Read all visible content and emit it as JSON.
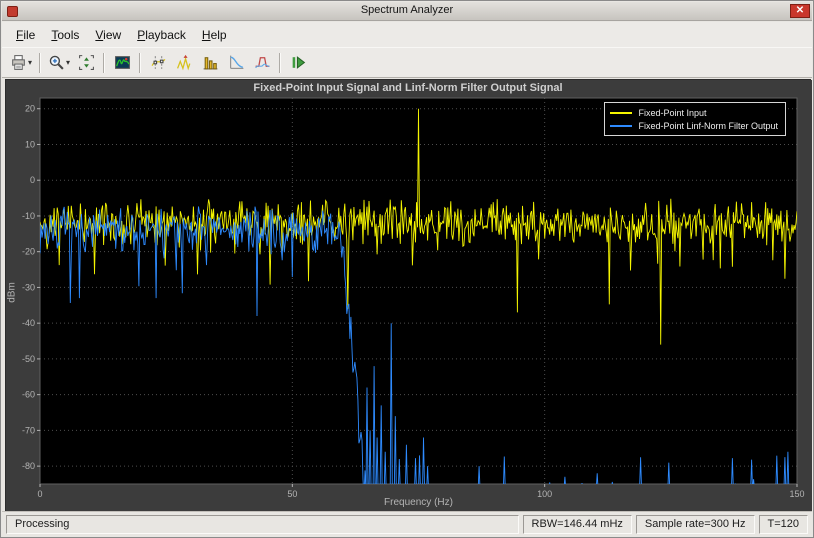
{
  "window": {
    "title": "Spectrum Analyzer",
    "close_glyph": "✕"
  },
  "menubar": {
    "items": [
      {
        "label": "File"
      },
      {
        "label": "Tools"
      },
      {
        "label": "View"
      },
      {
        "label": "Playback"
      },
      {
        "label": "Help"
      }
    ]
  },
  "toolbar": {
    "dropdown_glyph": "▾",
    "buttons": [
      {
        "name": "export",
        "icon": "printer-icon",
        "has_dropdown": true
      },
      {
        "name": "zoom-in",
        "icon": "magnifier-icon",
        "has_dropdown": true
      },
      {
        "name": "scale-axes",
        "icon": "fit-axes-icon",
        "has_dropdown": false
      },
      {
        "name": "spectrogram",
        "icon": "spectrogram-icon",
        "has_dropdown": false
      },
      {
        "name": "cursor-measurements",
        "icon": "cursor-measurements-icon",
        "has_dropdown": false
      },
      {
        "name": "peak-finder",
        "icon": "peak-finder-icon",
        "has_dropdown": false
      },
      {
        "name": "distortion-measurements",
        "icon": "distortion-bars-icon",
        "has_dropdown": false
      },
      {
        "name": "ccdf-measurements",
        "icon": "ccdf-curve-icon",
        "has_dropdown": false
      },
      {
        "name": "spectral-mask",
        "icon": "spectral-mask-icon",
        "has_dropdown": false
      },
      {
        "name": "step-forward",
        "icon": "step-forward-icon",
        "has_dropdown": false
      }
    ]
  },
  "statusbar": {
    "status": "Processing",
    "rbw": "RBW=146.44 mHz",
    "sample_rate": "Sample rate=300 Hz",
    "time": "T=120"
  },
  "chart_data": {
    "type": "line",
    "title": "Fixed-Point Input Signal and Linf-Norm Filter Output Signal",
    "xlabel": "Frequency (Hz)",
    "ylabel": "dBm",
    "xlim": [
      0,
      150
    ],
    "ylim": [
      -85,
      23
    ],
    "xticks": [
      0,
      50,
      100,
      150
    ],
    "yticks": [
      20,
      10,
      0,
      -10,
      -20,
      -30,
      -40,
      -50,
      -60,
      -70,
      -80
    ],
    "grid": true,
    "legend_position": "top-right",
    "background": "#000000",
    "series": [
      {
        "name": "Fixed-Point Input",
        "color": "#f5f500",
        "seed": 42,
        "freq_step_hz": 0.2,
        "noise_floor_dbm": -12,
        "noise_spread_db": 7,
        "dropout_prob": 0.05,
        "dropout_extra_db": 18,
        "tone": {
          "freq_hz": 75,
          "level_dbm": 20
        },
        "deep_nulls": [
          {
            "freq_hz": 61,
            "level_dbm": -36
          },
          {
            "freq_hz": 94.6,
            "level_dbm": -37
          },
          {
            "freq_hz": 123,
            "level_dbm": -46
          }
        ]
      },
      {
        "name": "Fixed-Point Linf-Norm Filter Output",
        "color": "#2e8bff",
        "seed": 7,
        "freq_step_hz": 0.2,
        "noise_floor_dbm": -14,
        "noise_spread_db": 7,
        "dropout_prob": 0.06,
        "dropout_extra_db": 16,
        "passband_edge_hz": 59.5,
        "stopband_start_hz": 64.5,
        "stopband_level_dbm": -87,
        "stopband_pop_prob": 0.04,
        "stopband_pop_db": 10,
        "deep_nulls": [
          {
            "freq_hz": 7.8,
            "level_dbm": -33
          },
          {
            "freq_hz": 23,
            "level_dbm": -33
          },
          {
            "freq_hz": 43,
            "level_dbm": -38
          }
        ],
        "stopband_spikes": [
          {
            "freq_hz": 64.8,
            "level_dbm": -58
          },
          {
            "freq_hz": 65.4,
            "level_dbm": -70
          },
          {
            "freq_hz": 66.2,
            "level_dbm": -52
          },
          {
            "freq_hz": 66.8,
            "level_dbm": -72
          },
          {
            "freq_hz": 67.6,
            "level_dbm": -63
          },
          {
            "freq_hz": 68.4,
            "level_dbm": -76
          },
          {
            "freq_hz": 69.6,
            "level_dbm": -40
          },
          {
            "freq_hz": 70.4,
            "level_dbm": -66
          },
          {
            "freq_hz": 71.2,
            "level_dbm": -78
          },
          {
            "freq_hz": 72.6,
            "level_dbm": -74
          },
          {
            "freq_hz": 75.2,
            "level_dbm": -77
          },
          {
            "freq_hz": 76,
            "level_dbm": -72
          },
          {
            "freq_hz": 76.8,
            "level_dbm": -80
          },
          {
            "freq_hz": 87,
            "level_dbm": -80
          },
          {
            "freq_hz": 110.4,
            "level_dbm": -82
          },
          {
            "freq_hz": 124.6,
            "level_dbm": -79
          },
          {
            "freq_hz": 148.2,
            "level_dbm": -76
          }
        ]
      }
    ]
  }
}
